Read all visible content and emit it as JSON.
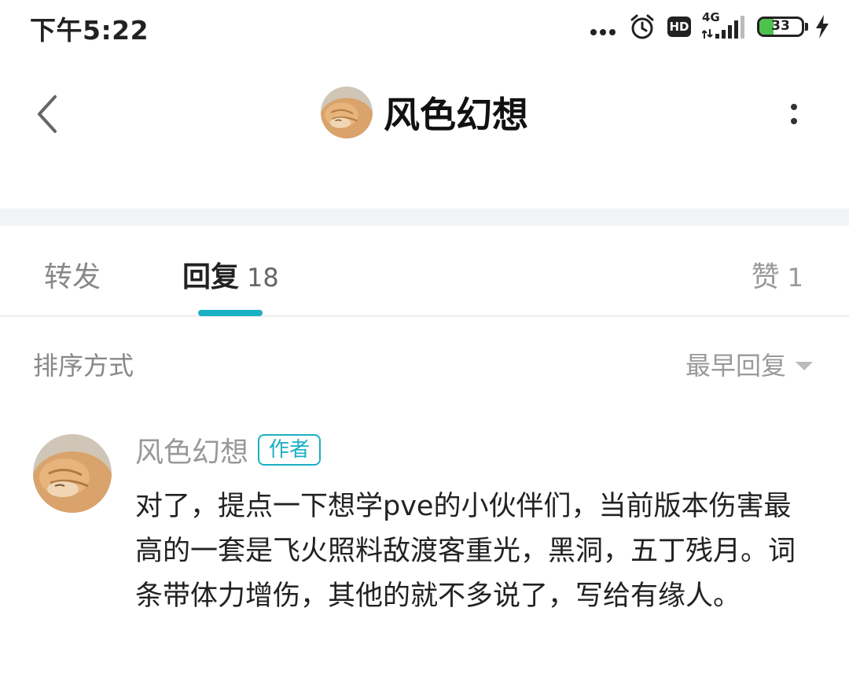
{
  "status_bar": {
    "time": "下午5:22",
    "network_gen": "4G",
    "battery_level": "33",
    "battery_fraction": 0.33,
    "battery_color": "#4cc24c",
    "icons": [
      "more-dots-icon",
      "alarm-icon",
      "hd-icon",
      "signal-icon",
      "battery-icon",
      "charging-bolt-icon"
    ]
  },
  "header": {
    "title": "风色幻想",
    "back_icon": "chevron-left-icon",
    "more_icon": "more-vertical-icon"
  },
  "tabs": {
    "forward": {
      "label": "转发"
    },
    "reply": {
      "label": "回复",
      "count": "18"
    },
    "like": {
      "label": "赞",
      "count": "1"
    },
    "accent_color": "#1ab0c4"
  },
  "sort": {
    "label": "排序方式",
    "value": "最早回复"
  },
  "comment": {
    "author": "风色幻想",
    "badge": "作者",
    "text": "对了，提点一下想学pve的小伙伴们，当前版本伤害最高的一套是飞火照料敌渡客重光，黑洞，五丁残月。词条带体力增伤，其他的就不多说了，写给有缘人。"
  }
}
